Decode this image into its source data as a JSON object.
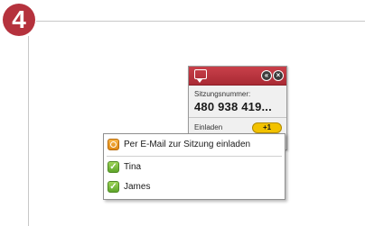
{
  "step": {
    "number": "4"
  },
  "panel": {
    "session_label": "Sitzungsnummer:",
    "session_number": "480 938 419...",
    "invite_label": "Einladen",
    "invite_button": "+1",
    "header_icons": [
      "chat-icon",
      "collapse-icon",
      "close-icon"
    ]
  },
  "invite_menu": {
    "email_item": "Per E-Mail zur Sitzung einladen",
    "contacts": [
      {
        "name": "Tina"
      },
      {
        "name": "James"
      }
    ]
  },
  "colors": {
    "accent": "#b5323d",
    "invite_button": "#f2c200",
    "contact_status": "#6db33f",
    "email_icon": "#f0a030"
  }
}
